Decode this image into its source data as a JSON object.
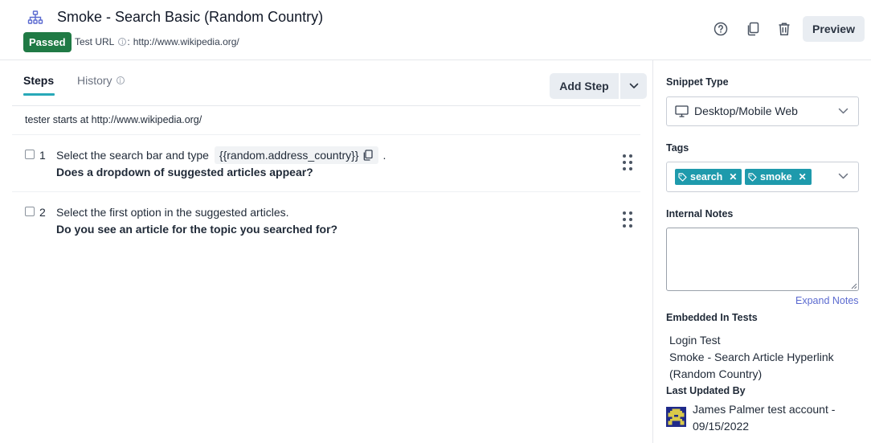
{
  "header": {
    "title": "Smoke - Search Basic (Random Country)",
    "status": "Passed",
    "test_url_label": "Test URL",
    "test_url_sep": ":",
    "test_url": "http://www.wikipedia.org/",
    "preview_label": "Preview",
    "icons": [
      "sitemap-icon",
      "help-icon",
      "copy-icon",
      "trash-icon"
    ],
    "status_color": "#207a45"
  },
  "tabs": {
    "steps_label": "Steps",
    "history_label": "History",
    "accent_color": "#28a9b8"
  },
  "toolbar": {
    "add_step_label": "Add Step"
  },
  "steps": {
    "starts_at": "tester starts at http://www.wikipedia.org/",
    "items": [
      {
        "number": "1",
        "action_prefix": "Select the search bar and type",
        "variable": "{{random.address_country}}",
        "action_suffix": ".",
        "question": "Does a dropdown of suggested articles appear?"
      },
      {
        "number": "2",
        "action_prefix": "Select the first option in the suggested articles.",
        "question": "Do you see an article for the topic you searched for?"
      }
    ]
  },
  "sidebar": {
    "snippet_type_label": "Snippet Type",
    "snippet_type_value": "Desktop/Mobile Web",
    "tags_label": "Tags",
    "tags": [
      "search",
      "smoke"
    ],
    "tag_color": "#1e9aac",
    "internal_notes_label": "Internal Notes",
    "internal_notes_value": "",
    "expand_notes_label": "Expand Notes",
    "embedded_label": "Embedded In Tests",
    "embedded_tests": [
      "Login Test",
      "Smoke - Search Article Hyperlink (Random Country)"
    ],
    "last_updated_label": "Last Updated By",
    "last_updated_value": "James Palmer test account - 09/15/2022"
  }
}
